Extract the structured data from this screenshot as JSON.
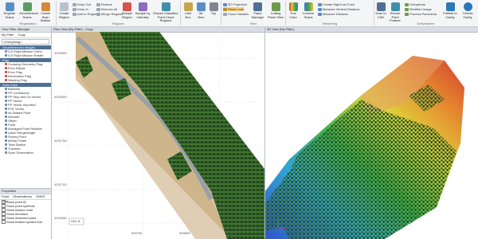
{
  "ribbon": {
    "groups": [
      {
        "label": "Registration",
        "buttons": [
          "Register Scans",
          "Georeference Scans",
          "Create Scan Station"
        ]
      },
      {
        "label": "",
        "small": [
          "Keep Out",
          "Keep In",
          "Add to Region"
        ],
        "small2": [
          "Restore",
          "Remove All",
          "Merge Regions"
        ],
        "buttons": [
          "Create Region",
          "Sample Region",
          "Sample by Intensity",
          "Extract Classified Point Cloud Regions"
        ]
      },
      {
        "label": "Regions",
        "buttons": [
          "Limit Box",
          "3D View",
          "Top"
        ]
      },
      {
        "label": "View",
        "small": [
          "3D Projection",
          "Plane Lock",
          "Cloud Handles"
        ],
        "buttons": [
          "Plane Manager",
          "Cutting Plane Slice"
        ]
      },
      {
        "label": "Rendering",
        "buttons": [
          "True Color",
          "Colorize Scans"
        ],
        "small": [
          "Create High/Low Point",
          "Measure Vertical Distance",
          "Measure Distance"
        ]
      },
      {
        "label": "Deliverables",
        "buttons": [
          "Scan to CAD",
          "Extract Point Feature"
        ],
        "small": [
          "Orthophoto",
          "Rectified Image",
          "Process Panorama"
        ],
        "buttons2": [
          "Publish to Clarity",
          "Trimble Clarity"
        ]
      }
    ]
  },
  "panel": {
    "header": "View Filter Manager",
    "tabs": [
      "My Filter",
      "Copy"
    ],
    "dropdown": "<Everything>",
    "sections": [
      {
        "title": "Georeferenced Images",
        "items": [
          "DJI Flight Mission Ortho",
          "DJI Flight Mission Raster"
        ]
      },
      {
        "title": "Flag",
        "items": [
          "Crossing Geometry Flag",
          "Error Ellipse",
          "Error Flag",
          "Information Flag",
          "Warning Flag"
        ]
      },
      {
        "title": "Scan Data",
        "items": [
          "Baseline",
          "PP Continuous",
          "PP Stop and Go Vector",
          "PP Vector",
          "PP Vector Imported",
          "RTK Vector",
          "As Staked Point",
          "Azimuth",
          "Offset",
          "Point",
          "Averaged Point Relative",
          "Laser Range/Angle",
          "Survey Point",
          "Media Folder",
          "Total Station",
          "Traverse",
          "Scan Observation"
        ]
      }
    ],
    "props_header": "Properties",
    "props_tabs": [
      "Point",
      "Observations",
      "GNSS Obs"
    ],
    "checkboxes": [
      "Show point ID",
      "Show point symbols",
      "Show feature code",
      "Show elevation",
      "Show observed point",
      "Show feature symbol info"
    ]
  },
  "plan_view": {
    "title": "Plan View (My Filter) - Copy",
    "y_labels": [
      "4201850",
      "4201800",
      "4201750",
      "4201700",
      "4201650"
    ],
    "x_labels": [
      "590750",
      "590800",
      "590850"
    ],
    "scale": "VCL 5"
  },
  "view3d": {
    "title": "3D View (My Filter)"
  }
}
